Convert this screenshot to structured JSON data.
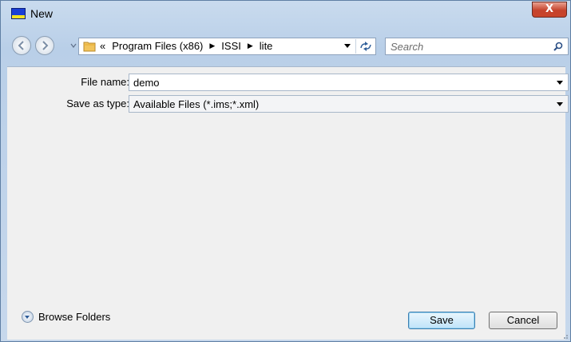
{
  "window": {
    "title": "New",
    "close_label": "X"
  },
  "navigation": {
    "breadcrumb_overflow": "«",
    "breadcrumbs": [
      "Program Files (x86)",
      "ISSI",
      "lite"
    ],
    "search_placeholder": "Search"
  },
  "form": {
    "file_name_label": "File name:",
    "file_name_value": "demo",
    "save_type_label": "Save as type:",
    "save_type_value": "Available Files (*.ims;*.xml)"
  },
  "footer": {
    "browse_folders_label": "Browse Folders",
    "save_label": "Save",
    "cancel_label": "Cancel"
  }
}
